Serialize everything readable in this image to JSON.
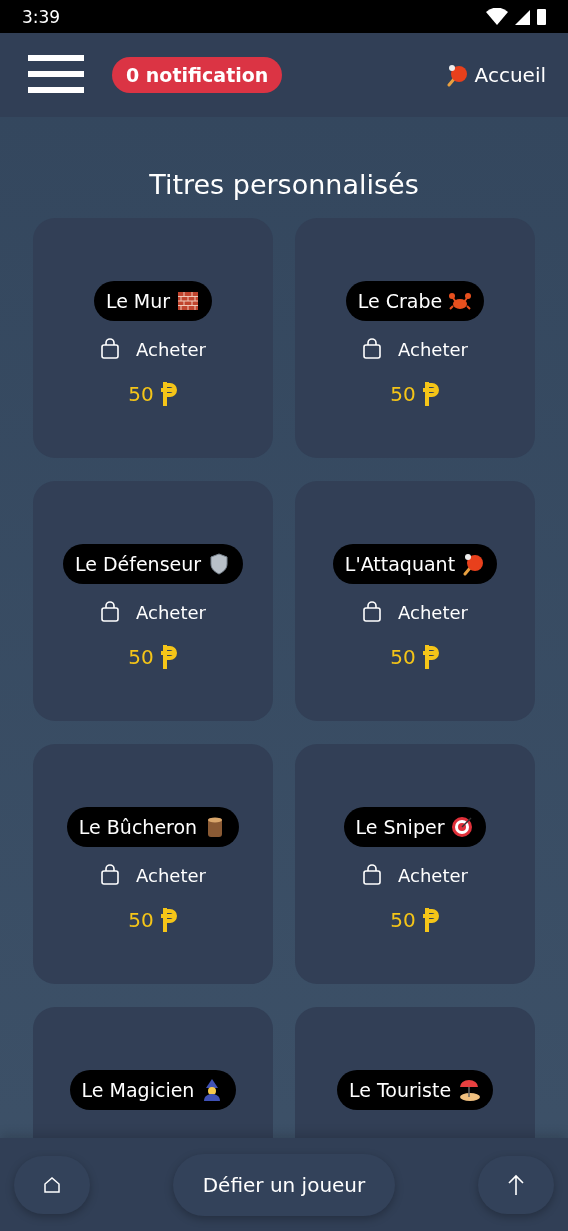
{
  "status_bar": {
    "time": "3:39"
  },
  "header": {
    "notifications": "0 notification",
    "home_link": "Accueil"
  },
  "title": "Titres personnalisés",
  "cards": [
    {
      "title": "Le Mur",
      "kind": "wall",
      "action": "Acheter",
      "price": "50"
    },
    {
      "title": "Le Crabe",
      "kind": "crab",
      "action": "Acheter",
      "price": "50"
    },
    {
      "title": "Le Défenseur",
      "kind": "shield",
      "action": "Acheter",
      "price": "50"
    },
    {
      "title": "L'Attaquant",
      "kind": "paddle",
      "action": "Acheter",
      "price": "50"
    },
    {
      "title": "Le Bûcheron",
      "kind": "log",
      "action": "Acheter",
      "price": "50"
    },
    {
      "title": "Le Sniper",
      "kind": "target",
      "action": "Acheter",
      "price": "50"
    },
    {
      "title": "Le Magicien",
      "kind": "mage"
    },
    {
      "title": "Le Touriste",
      "kind": "beach"
    }
  ],
  "bottom_bar": {
    "challenge_button": "Défier un joueur"
  }
}
